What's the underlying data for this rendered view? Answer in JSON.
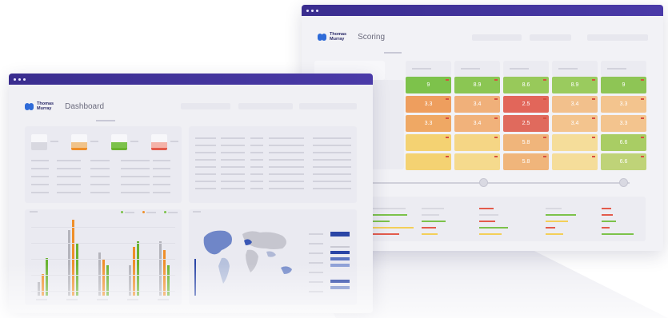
{
  "brand": {
    "name_line1": "Thomas",
    "name_line2": "Murray",
    "accent": "#4a3aa8",
    "logo_blue": "#2f6bd8"
  },
  "dashboard": {
    "title": "Dashboard"
  },
  "scoring": {
    "title": "Scoring",
    "grid": [
      [
        "9",
        "8.9",
        "8.6",
        "8.9",
        "9"
      ],
      [
        "3.3",
        "3.4",
        "2.5",
        "3.4",
        "3.3"
      ],
      [
        "3.3",
        "3.4",
        "2.5",
        "3.4",
        "3.3"
      ],
      [
        "",
        "",
        "5.8",
        "",
        "6.6"
      ],
      [
        "",
        "",
        "5.8",
        "",
        "6.6"
      ]
    ]
  },
  "colors": {
    "green": "#7cc24a",
    "orange": "#ef9a4a",
    "red": "#e35b4c",
    "yellow": "#f3cf58",
    "bar_grey": "#b4b4bc",
    "bar_orange": "#ef8f2a",
    "bar_green": "#6ab330",
    "map_blue": "#2a45a6"
  },
  "icons": [
    "window-dot",
    "logo-mark",
    "slider-knob"
  ]
}
